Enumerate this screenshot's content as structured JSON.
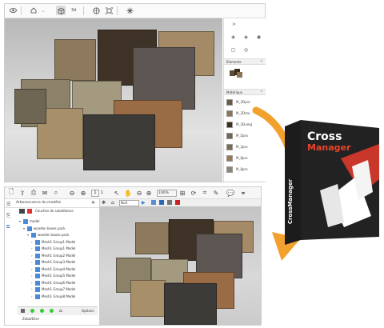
{
  "top_window": {
    "toolbar_icons": [
      "eye-icon",
      "home-icon",
      "chevron-down-icon",
      "cube-view-icon",
      "3d-text-icon",
      "globe-icon",
      "fit-icon",
      "sparkle-icon"
    ],
    "toolbar_3d_label": "3d",
    "panel_expand": ">",
    "section_elements": "Elements",
    "section_materials": "Matériaux",
    "materials": [
      {
        "label": "M_3Dpro",
        "color": "#6b5a45"
      },
      {
        "label": "M_3Dmo",
        "color": "#8a7556"
      },
      {
        "label": "M_3Dumg",
        "color": "#3e2e1e"
      },
      {
        "label": "M_Dpro",
        "color": "#746552"
      },
      {
        "label": "M_3pro",
        "color": "#7a6a50"
      },
      {
        "label": "M_8pro",
        "color": "#9a7a55"
      },
      {
        "label": "M_8pro",
        "color": "#8f8678"
      }
    ]
  },
  "bottom_window": {
    "page_value": "1",
    "page_total": "1",
    "zoom": "100%",
    "panel_title": "Arborescence du modèle",
    "panel_close": "✕",
    "layer_select": "Couches de substitance",
    "tree": [
      {
        "label": "model",
        "level": 0
      },
      {
        "label": "wooden boxes pack",
        "level": 1
      },
      {
        "label": "wooden boxes pack",
        "level": 2
      },
      {
        "label": "Mesh1 Group1 Model",
        "level": 3
      },
      {
        "label": "Mesh1 Group1 Model",
        "level": 3
      },
      {
        "label": "Mesh1 Group2 Model",
        "level": 3
      },
      {
        "label": "Mesh1 Group3 Model",
        "level": 3
      },
      {
        "label": "Mesh1 Group4 Model",
        "level": 3
      },
      {
        "label": "Mesh1 Group5 Model",
        "level": 3
      },
      {
        "label": "Mesh1 Group6 Model",
        "level": 3
      },
      {
        "label": "Mesh1 Group7 Model",
        "level": 3
      },
      {
        "label": "Mesh1 Group8 Model",
        "level": 3
      }
    ],
    "options_label": "Options",
    "footer_label": "Zoba/Elise",
    "sub_select": "Nuit"
  },
  "product": {
    "brand_line1": "Cross",
    "brand_line2": "Manager",
    "spine": "CrossManager",
    "accent": "#e8432a",
    "dark": "#1a1a1a"
  },
  "colors": {
    "arrow": "#f2a12e"
  }
}
